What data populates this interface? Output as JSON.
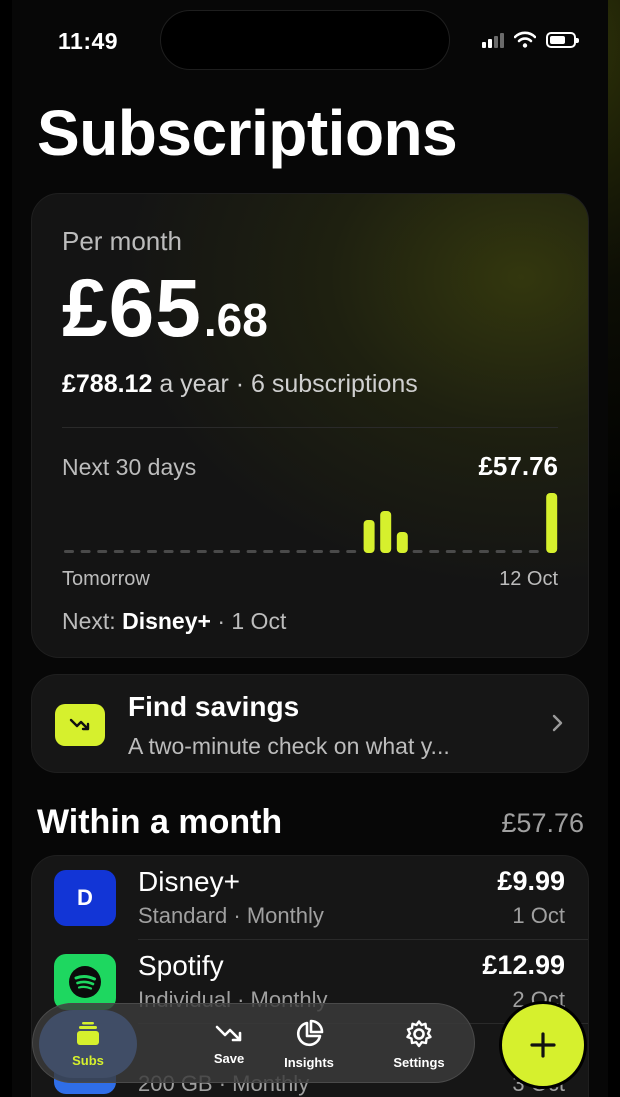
{
  "status": {
    "time": "11:49"
  },
  "title": "Subscriptions",
  "summary": {
    "per_month_label": "Per month",
    "amount_main": "£65",
    "amount_decimal": ".68",
    "yearly": "£788.12",
    "yearly_suffix": " a year · 6 subscriptions",
    "next30_label": "Next 30 days",
    "next30_amount": "£57.76",
    "start_label": "Tomorrow",
    "end_label": "12 Oct",
    "next_prefix": "Next: ",
    "next_name": "Disney+",
    "next_suffix": " · 1 Oct"
  },
  "upcoming_bars": [
    {
      "day": 18,
      "level": 0.55
    },
    {
      "day": 19,
      "level": 0.7
    },
    {
      "day": 20,
      "level": 0.35
    },
    {
      "day": 29,
      "level": 1.0
    }
  ],
  "savings": {
    "title": "Find savings",
    "subtitle": "A two-minute check on what y..."
  },
  "section": {
    "title": "Within a month",
    "total": "£57.76"
  },
  "subscriptions": [
    {
      "name": "Disney+",
      "meta": "Standard · Monthly",
      "price": "£9.99",
      "date": "1 Oct",
      "logo_text": "D",
      "logo_color": "#1235d6"
    },
    {
      "name": "Spotify",
      "meta": "Individual · Monthly",
      "price": "£12.99",
      "date": "2 Oct",
      "logo_text": "",
      "logo_color": "#1ed760"
    },
    {
      "name": "",
      "meta": "200 GB · Monthly",
      "price": "£",
      "date": "3 Oct",
      "logo_text": "",
      "logo_color": "#2f6ee8"
    }
  ],
  "tabs": [
    {
      "label": "Subs",
      "icon": "subs-icon"
    },
    {
      "label": "Save",
      "icon": "trend-down-icon"
    },
    {
      "label": "Insights",
      "icon": "pie-chart-icon"
    },
    {
      "label": "Settings",
      "icon": "gear-icon"
    }
  ],
  "colors": {
    "accent": "#d6f02d",
    "background": "#070707",
    "card": "#161616"
  }
}
